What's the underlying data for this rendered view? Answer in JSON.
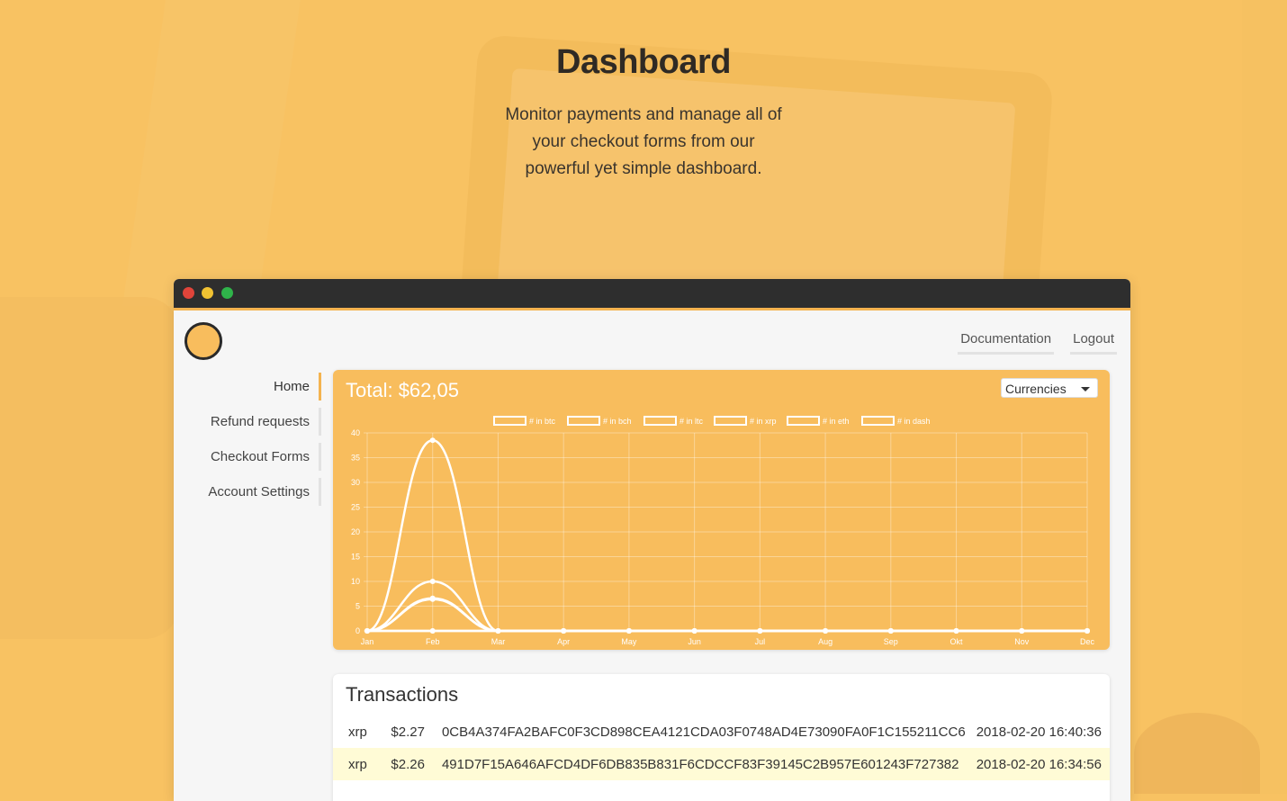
{
  "hero": {
    "title": "Dashboard",
    "subtitle": "Monitor payments and manage all of your checkout forms from our powerful yet simple dashboard."
  },
  "topnav": {
    "documentation": "Documentation",
    "logout": "Logout"
  },
  "sidebar": {
    "items": [
      {
        "label": "Home",
        "active": true
      },
      {
        "label": "Refund requests",
        "active": false
      },
      {
        "label": "Checkout Forms",
        "active": false
      },
      {
        "label": "Account Settings",
        "active": false
      }
    ]
  },
  "summary": {
    "total": "Total: $62,05",
    "currency_select": "Currencies"
  },
  "chart_data": {
    "type": "line",
    "categories": [
      "Jan",
      "Feb",
      "Mar",
      "Apr",
      "May",
      "Jun",
      "Jul",
      "Aug",
      "Sep",
      "Okt",
      "Nov",
      "Dec"
    ],
    "series": [
      {
        "name": "# in btc",
        "values": [
          0,
          38.5,
          0,
          0,
          0,
          0,
          0,
          0,
          0,
          0,
          0,
          0
        ]
      },
      {
        "name": "# in bch",
        "values": [
          0,
          10,
          0,
          0,
          0,
          0,
          0,
          0,
          0,
          0,
          0,
          0
        ]
      },
      {
        "name": "# in ltc",
        "values": [
          0,
          6.6,
          0,
          0,
          0,
          0,
          0,
          0,
          0,
          0,
          0,
          0
        ]
      },
      {
        "name": "# in xrp",
        "values": [
          0,
          6.4,
          0,
          0,
          0,
          0,
          0,
          0,
          0,
          0,
          0,
          0
        ]
      },
      {
        "name": "# in eth",
        "values": [
          0,
          0,
          0,
          0,
          0,
          0,
          0,
          0,
          0,
          0,
          0,
          0
        ]
      },
      {
        "name": "# in dash",
        "values": [
          0,
          0,
          0,
          0,
          0,
          0,
          0,
          0,
          0,
          0,
          0,
          0
        ]
      }
    ],
    "yticks": [
      0,
      5,
      10,
      15,
      20,
      25,
      30,
      35,
      40
    ],
    "ylim": [
      0,
      40
    ],
    "grid": true,
    "legend": "top",
    "line_color": "#ffffff"
  },
  "transactions": {
    "title": "Transactions",
    "rows": [
      {
        "currency": "xrp",
        "amount": "$2.27",
        "hash": "0CB4A374FA2BAFC0F3CD898CEA4121CDA03F0748AD4E73090FA0F1C155211CC6",
        "time": "2018-02-20 16:40:36"
      },
      {
        "currency": "xrp",
        "amount": "$2.26",
        "hash": "491D7F15A646AFCD4DF6DB835B831F6CDCCF83F39145C2B957E601243F727382",
        "time": "2018-02-20 16:34:56"
      }
    ]
  },
  "colors": {
    "background": "#f8c262",
    "accent": "#f4b34f",
    "titlebar": "#2e2e2e",
    "row_highlight": "#fffbd6"
  }
}
